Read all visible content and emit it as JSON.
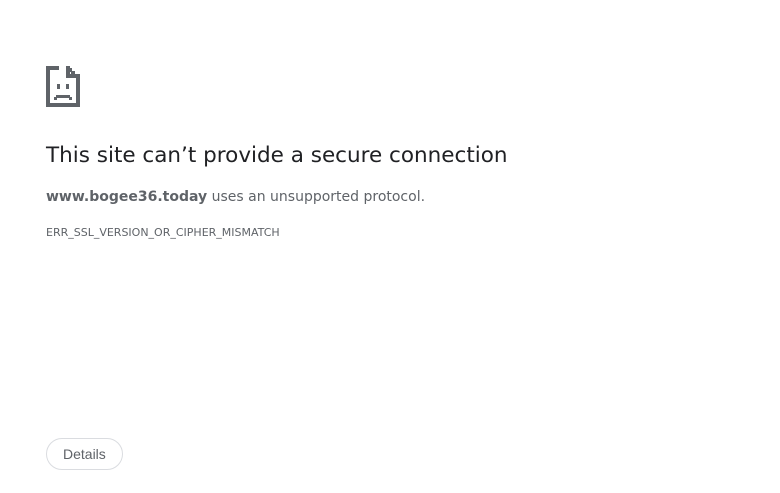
{
  "page": {
    "icon": "sad-page-icon",
    "title": "This site can’t provide a secure connection",
    "message": {
      "host": "www.bogee36.today",
      "text": " uses an unsupported protocol."
    },
    "error_code": "ERR_SSL_VERSION_OR_CIPHER_MISMATCH",
    "details_button": "Details"
  },
  "colors": {
    "title": "#202124",
    "secondary_text": "#5f6368",
    "button_border": "#dadce0"
  }
}
